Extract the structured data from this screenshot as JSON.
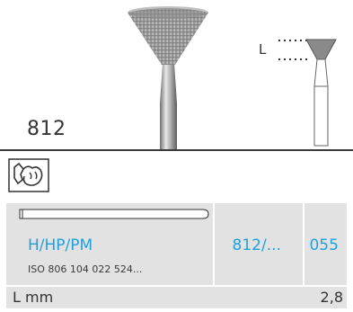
{
  "product": {
    "model_number": "812",
    "length_marker": "L"
  },
  "icons": {
    "grip_icon": "handpiece-icon"
  },
  "table": {
    "shank_type": "H/HP/PM",
    "iso_code": "ISO 806 104 022 524...",
    "ref_number": "812/...",
    "size": "055",
    "length_label": "L mm",
    "length_value": "2,8"
  },
  "colors": {
    "accent_blue": "#1fa0dc",
    "table_bg": "#e2e2e2",
    "rule": "#3b3b3b"
  }
}
